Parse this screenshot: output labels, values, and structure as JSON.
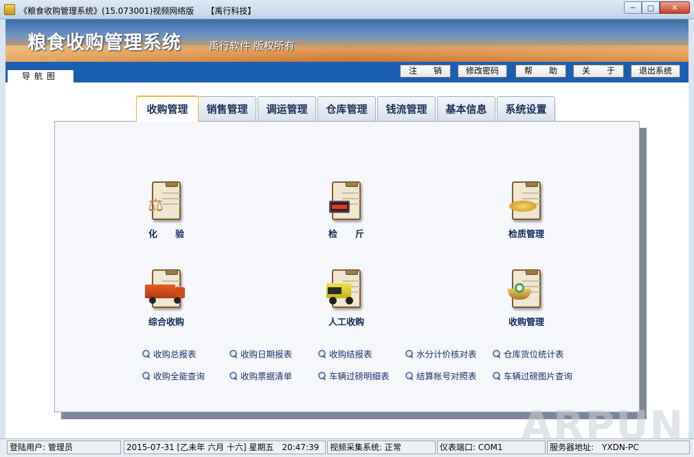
{
  "window": {
    "title": "《粮食收购管理系统》(15.073001)视频网络版　　【禹行科技】",
    "minimize_glyph": "─",
    "maximize_glyph": "□",
    "close_glyph": "✕"
  },
  "banner": {
    "title": "粮食收购管理系统",
    "subtitle": "禹行软件 版权所有"
  },
  "nav_tab": {
    "label": "导航图"
  },
  "top_buttons": {
    "logout": "注　　销",
    "change_password": "修改密码",
    "help": "帮　　助",
    "about": "关　　于",
    "exit": "退出系统"
  },
  "tabs": [
    {
      "label": "收购管理",
      "active": true
    },
    {
      "label": "销售管理"
    },
    {
      "label": "调运管理"
    },
    {
      "label": "仓库管理"
    },
    {
      "label": "钱流管理"
    },
    {
      "label": "基本信息"
    },
    {
      "label": "系统设置"
    }
  ],
  "modules": [
    {
      "label": "化　　验",
      "icon": "scale-icon"
    },
    {
      "label": "检　　斤",
      "icon": "weighing-display-icon"
    },
    {
      "label": "检质管理",
      "icon": "grain-icon"
    },
    {
      "label": "综合收购",
      "icon": "truck-icon"
    },
    {
      "label": "人工收购",
      "icon": "dump-truck-icon"
    },
    {
      "label": "收购管理",
      "icon": "basket-icon"
    }
  ],
  "reports": [
    "收购总报表",
    "收购日期报表",
    "收购结报表",
    "水分计价核对表",
    "仓库货位统计表",
    "收购全能查询",
    "收购票据清单",
    "车辆过磅明细表",
    "结算帐号对照表",
    "车辆过磅图片查询"
  ],
  "status": {
    "user": "登陆用户: 管理员",
    "datetime": "2015-07-31 [乙未年 六月 十六] 星期五　20:47:39",
    "video": "视频采集系统: 正常",
    "port": "仪表端口: COM1",
    "server": "服务器地址:　YXDN-PC"
  },
  "watermark": "ARPUN",
  "colors": {
    "accent_blue": "#1b5fb3",
    "tab_active_border": "#f0b63a",
    "module_label": "#11285a"
  }
}
